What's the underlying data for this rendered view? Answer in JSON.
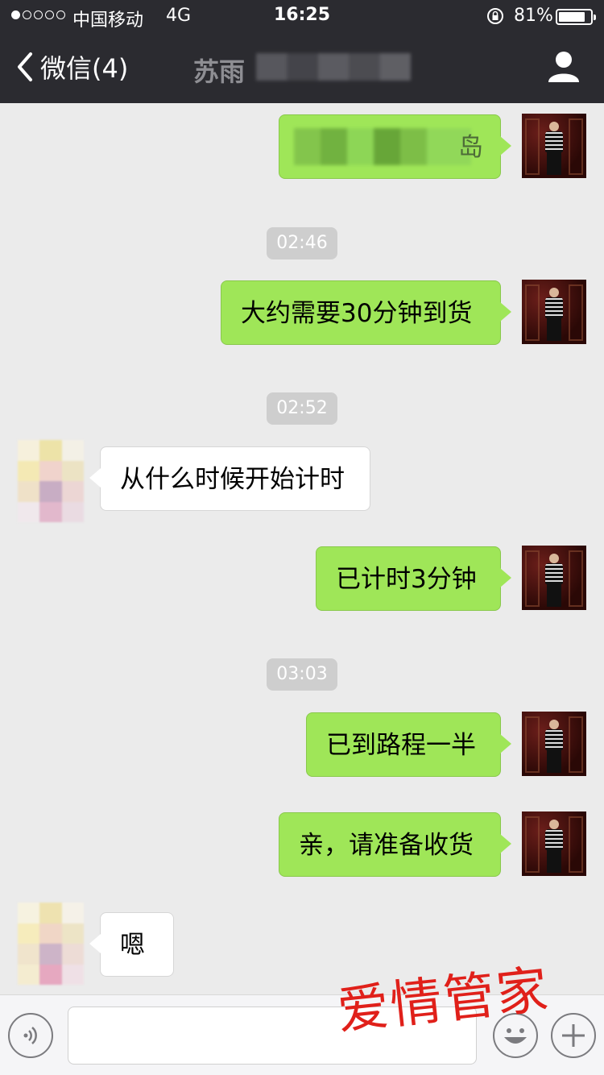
{
  "status_bar": {
    "carrier": "中国移动",
    "network": "4G",
    "time": "16:25",
    "battery_percent": "81%",
    "battery_level": 0.81
  },
  "nav": {
    "back_label": "微信(4)",
    "title_visible": "苏雨"
  },
  "messages": {
    "m1": "岛",
    "t1": "02:46",
    "m2": "大约需要30分钟到货",
    "t2": "02:52",
    "m3": "从什么时候开始计时",
    "m4": "已计时3分钟",
    "t3": "03:03",
    "m5": "已到路程一半",
    "m6": "亲，请准备收货",
    "m7": "嗯"
  },
  "colors": {
    "outgoing_bubble": "#9fe658",
    "incoming_bubble": "#ffffff",
    "bar_background": "#2b2b30",
    "watermark": "#e0201a"
  },
  "watermark": "爱情管家",
  "icons": {
    "back": "chevron-left-icon",
    "profile": "person-icon",
    "voice": "voice-icon",
    "emoji": "smiley-icon",
    "plus": "plus-icon",
    "orientation_lock": "rotation-lock-icon"
  }
}
